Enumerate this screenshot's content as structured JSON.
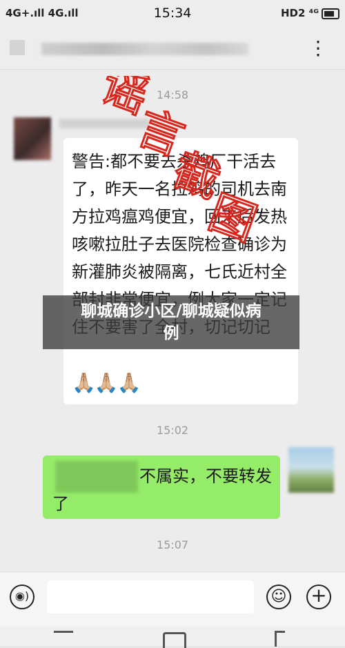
{
  "status_bar": {
    "left_signal": "4G+.ıll 4G.ıll",
    "time": "15:34",
    "right_status": "HD2 ⁴ᴳ"
  },
  "nav": {
    "more_glyph": "⋮"
  },
  "chat": {
    "timestamps": [
      "14:58",
      "15:02",
      "15:07"
    ],
    "incoming_message": "警告:都不要去杀鸡厂干活去了，昨天一名拉鸡的司机去南方拉鸡瘟鸡便宜，回来后发热咳嗽拉肚子去医院检查确诊为新灌肺炎被隔离，七氏近村全部封非常便宜，例大家一定记住不要害了全村，切记切记",
    "incoming_emoji": "🙏🏼🙏🏼🙏🏼",
    "outgoing_message": "不属实，不要转发了",
    "stamp_text": "谣言截图"
  },
  "headline": {
    "line1": "聊城确诊小区/聊城疑似病",
    "line2": "例"
  },
  "input_bar": {
    "voice_glyph": "◉)",
    "emoji_glyph": "☺",
    "plus_glyph": "+"
  },
  "colors": {
    "outgoing_bubble": "#95ec69",
    "incoming_bubble": "#ffffff",
    "stamp_red": "#d9261c"
  }
}
